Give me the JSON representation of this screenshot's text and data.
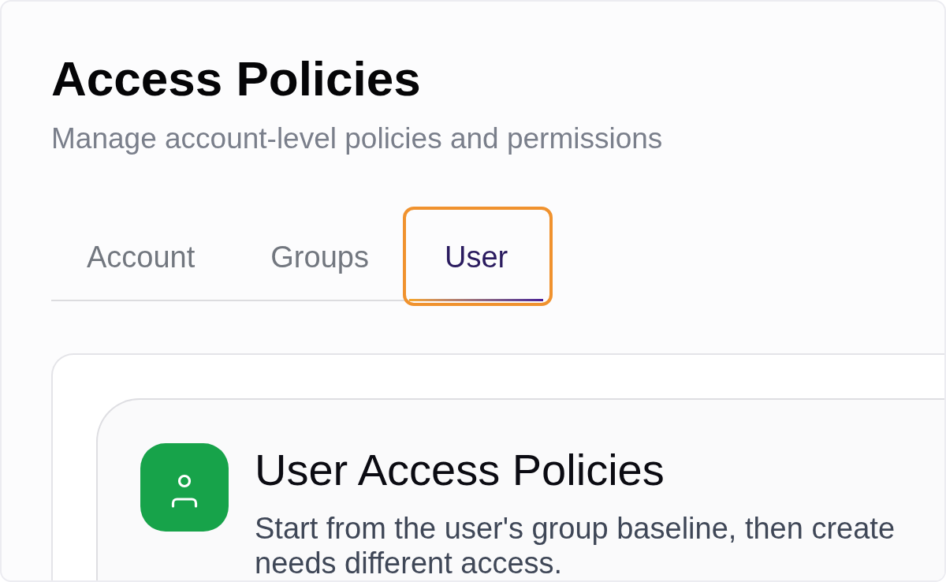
{
  "page": {
    "title": "Access Policies",
    "subtitle": "Manage account-level policies and permissions"
  },
  "tabs": [
    {
      "label": "Account",
      "selected": false,
      "highlighted": false
    },
    {
      "label": "Groups",
      "selected": false,
      "highlighted": false
    },
    {
      "label": "User",
      "selected": true,
      "highlighted": true
    }
  ],
  "policy_card": {
    "title": "User Access Policies",
    "description_lines": [
      "Start from the user's group baseline, then create",
      "needs different access."
    ]
  }
}
